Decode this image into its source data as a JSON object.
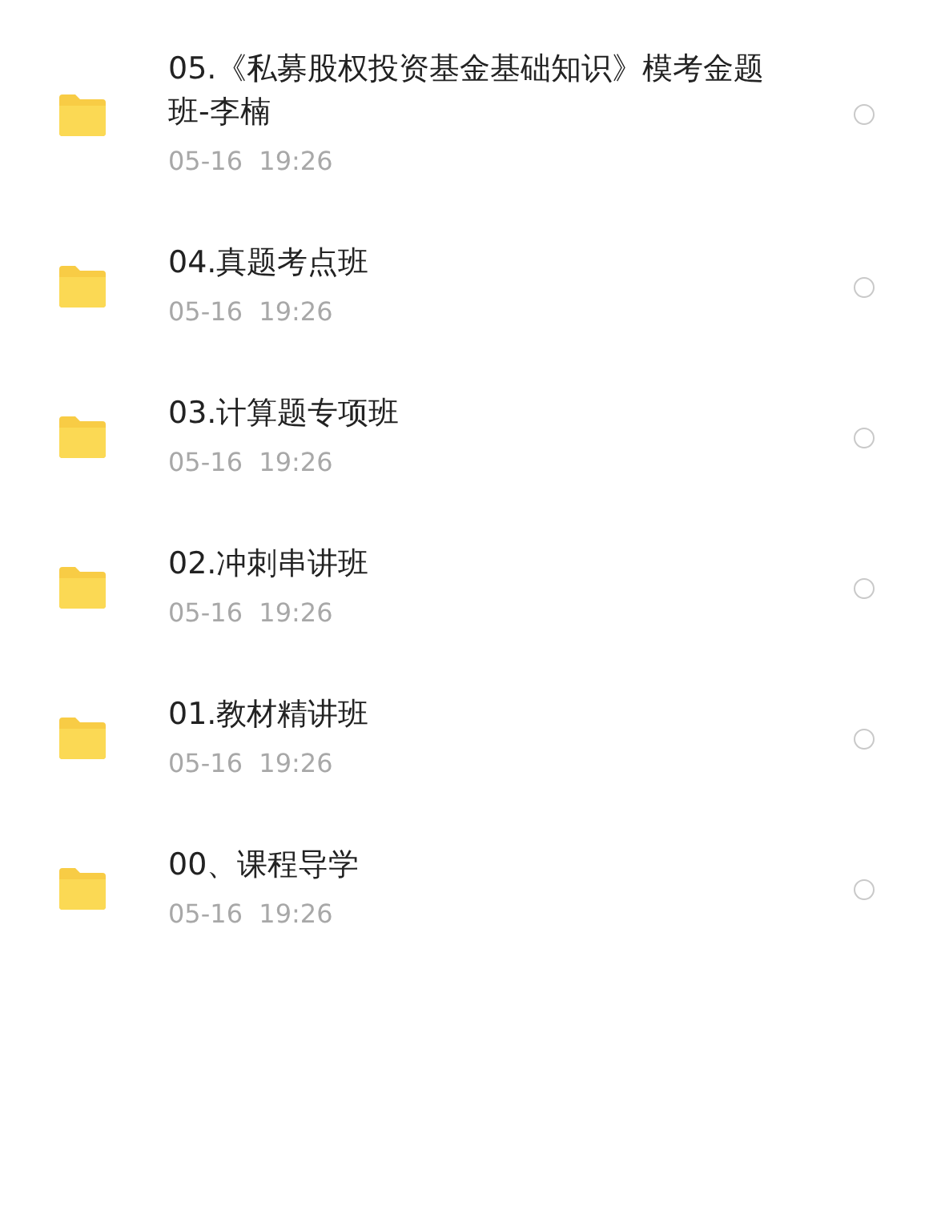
{
  "files": [
    {
      "name": "05.《私募股权投资基金基础知识》模考金题班-李楠",
      "date": "05-16  19:26",
      "selected": false
    },
    {
      "name": "04.真题考点班",
      "date": "05-16  19:26",
      "selected": false
    },
    {
      "name": "03.计算题专项班",
      "date": "05-16  19:26",
      "selected": false
    },
    {
      "name": "02.冲刺串讲班",
      "date": "05-16  19:26",
      "selected": false
    },
    {
      "name": "01.教材精讲班",
      "date": "05-16  19:26",
      "selected": false
    },
    {
      "name": "00、课程导学",
      "date": "05-16  19:26",
      "selected": false
    }
  ]
}
